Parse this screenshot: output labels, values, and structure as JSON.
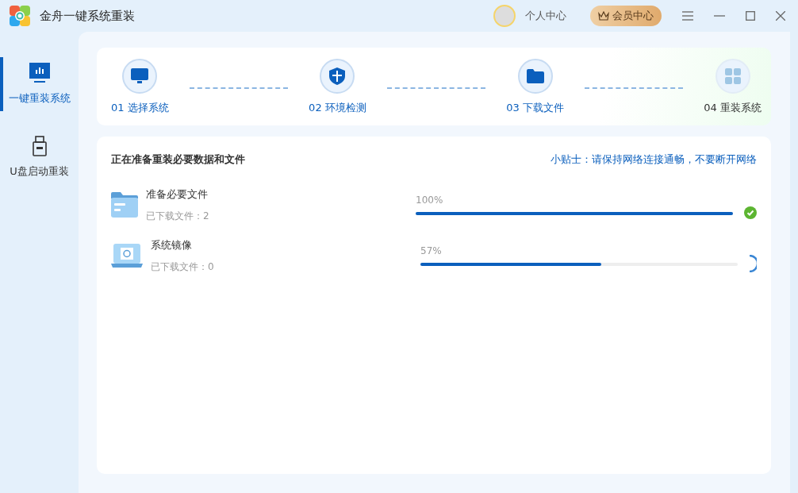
{
  "window": {
    "title": "金舟一键系统重装"
  },
  "header": {
    "profile": "个人中心",
    "vip": "会员中心"
  },
  "sidebar": {
    "items": [
      {
        "label": "一键重装系统",
        "selected": true,
        "kind": "monitor"
      },
      {
        "label": "U盘启动重装",
        "selected": false,
        "kind": "usb"
      }
    ]
  },
  "steps": [
    {
      "label": "01 选择系统",
      "done": true,
      "kind": "monitor"
    },
    {
      "label": "02 环境检测",
      "done": true,
      "kind": "shield"
    },
    {
      "label": "03 下载文件",
      "done": true,
      "kind": "folder"
    },
    {
      "label": "04 重装系统",
      "done": false,
      "kind": "windows"
    }
  ],
  "task_panel": {
    "title": "正在准备重装必要数据和文件",
    "tip": "小贴士：请保持网络连接通畅，不要断开网络",
    "tasks": [
      {
        "name": "准备必要文件",
        "detail": "已下载文件：2",
        "percent": "100%",
        "level": 1,
        "kind": "folder",
        "complete": true
      },
      {
        "name": "系统镜像",
        "detail": "已下载文件：0",
        "percent": "57%",
        "level": 0.57,
        "kind": "laptop",
        "complete": false
      }
    ]
  }
}
